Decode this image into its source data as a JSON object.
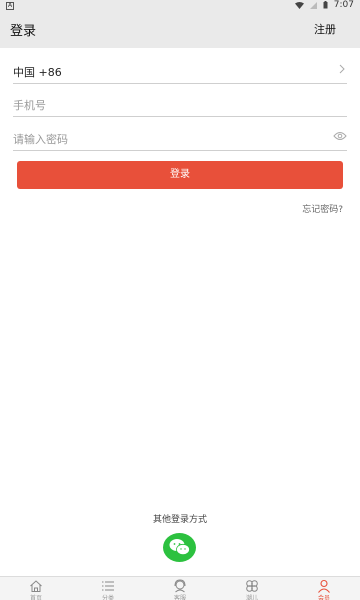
{
  "status_bar": {
    "app_badge": "A",
    "time": "7:07"
  },
  "header": {
    "title": "登录",
    "register_label": "注册"
  },
  "form": {
    "country_code": "中国 +86",
    "phone_placeholder": "手机号",
    "password_placeholder": "请输入密码",
    "login_label": "登录",
    "forgot_label": "忘记密码?"
  },
  "other_login": {
    "label": "其他登录方式",
    "options": [
      "wechat-icon"
    ]
  },
  "colors": {
    "accent": "#e8503a",
    "wechat": "#2cc13f",
    "appbar": "#eaeaea"
  },
  "tabs": [
    {
      "label": "首页",
      "icon": "home-icon",
      "active": false
    },
    {
      "label": "分类",
      "icon": "list-icon",
      "active": false
    },
    {
      "label": "客服",
      "icon": "service-icon",
      "active": false
    },
    {
      "label": "潮儿",
      "icon": "clover-icon",
      "active": false
    },
    {
      "label": "会员",
      "icon": "user-icon",
      "active": true
    }
  ]
}
